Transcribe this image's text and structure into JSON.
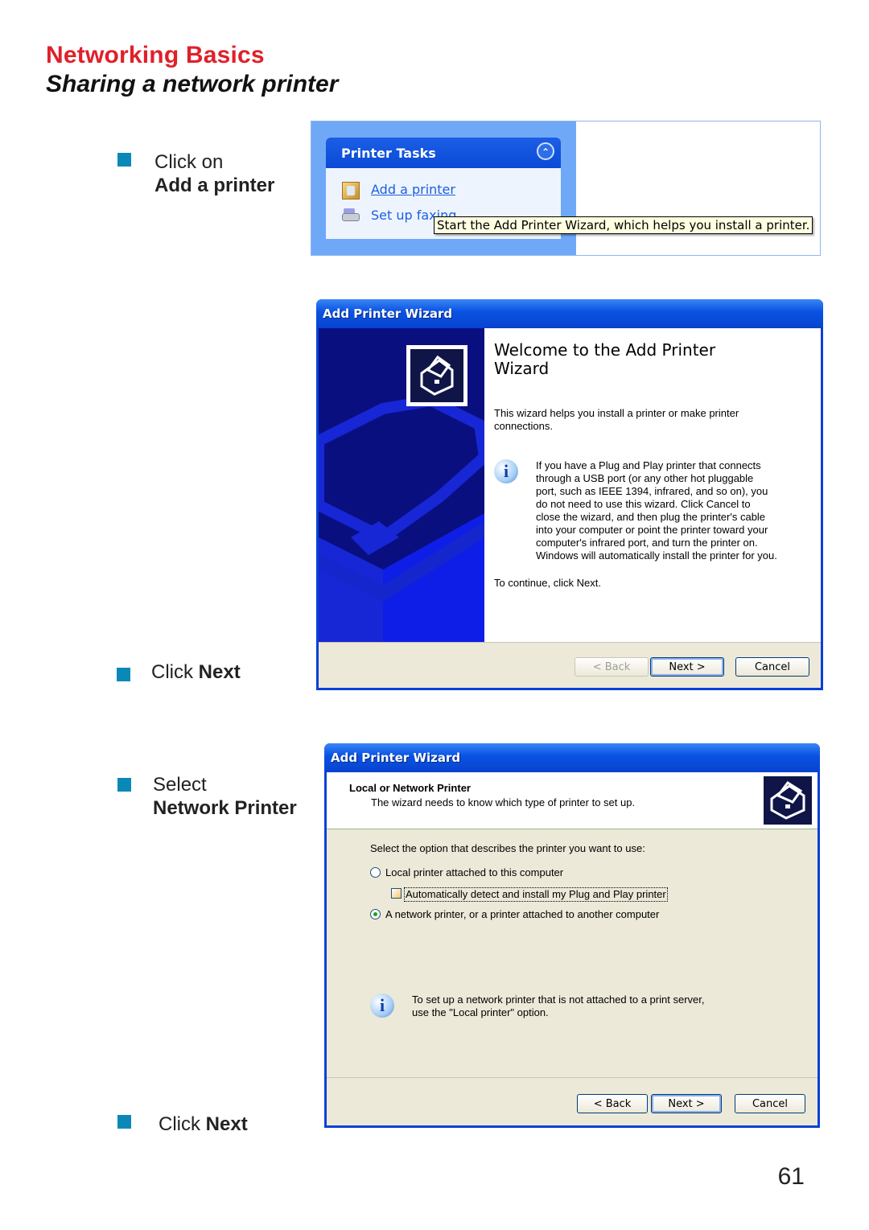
{
  "header": {
    "section": "Networking Basics",
    "title": "Sharing a network printer"
  },
  "steps": [
    {
      "line1": "Click on",
      "line2": "Add a printer"
    },
    {
      "prefix": "Click ",
      "bold": "Next"
    },
    {
      "line1": "Select",
      "line2": "Network Printer"
    },
    {
      "prefix": "Click ",
      "bold": "Next"
    }
  ],
  "printer_tasks": {
    "title": "Printer Tasks",
    "collapse_icon": "double-chevron-up",
    "items": [
      {
        "label": "Add a printer",
        "icon": "add-printer-icon"
      },
      {
        "label": "Set up faxing",
        "icon": "fax-icon"
      }
    ],
    "tooltip": "Start the Add Printer Wizard, which helps you install a printer."
  },
  "wizard1": {
    "title": "Add Printer Wizard",
    "heading_line1": "Welcome to the Add Printer",
    "heading_line2": "Wizard",
    "intro_line1": "This wizard helps you install a printer or make printer",
    "intro_line2": "connections.",
    "info_lines": [
      "If you have a Plug and Play printer that connects",
      "through a USB port (or any other hot pluggable",
      "port, such as IEEE 1394, infrared, and so on), you",
      "do not need to use this wizard. Click Cancel to",
      "close the wizard, and then plug the printer's cable",
      "into your computer or point the printer toward your",
      "computer's infrared port, and turn the printer on.",
      "Windows will automatically install the printer for you."
    ],
    "continue": "To continue, click Next.",
    "buttons": {
      "back": "< Back",
      "next": "Next >",
      "cancel": "Cancel"
    }
  },
  "wizard2": {
    "title": "Add Printer Wizard",
    "header_title": "Local or Network Printer",
    "header_subtitle": "The wizard needs to know which type of printer to set up.",
    "prompt": "Select the option that describes the printer you want to use:",
    "options": {
      "local": {
        "label": "Local printer attached to this computer",
        "selected": false
      },
      "auto_detect": {
        "label": "Automatically detect and install my Plug and Play printer",
        "checked": false
      },
      "network": {
        "label": "A network printer, or a printer attached to another computer",
        "selected": true
      }
    },
    "info_line1": "To set up a network printer that is not attached to a print server,",
    "info_line2": "use the \"Local printer\" option.",
    "buttons": {
      "back": "< Back",
      "next": "Next >",
      "cancel": "Cancel"
    }
  },
  "page_number": "61"
}
